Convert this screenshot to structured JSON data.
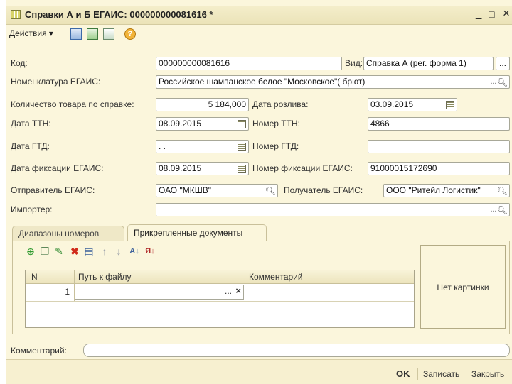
{
  "window": {
    "title": "Справки А и Б ЕГАИС: 000000000081616 *",
    "minimize": "_",
    "maximize": "□",
    "close": "×"
  },
  "toolbar": {
    "actions_label": "Действия ▾"
  },
  "form": {
    "code_label": "Код:",
    "code_value": "000000000081616",
    "kind_label": "Вид:",
    "kind_value": "Справка А (рег. форма 1)",
    "nomenclature_label": "Номенклатура ЕГАИС:",
    "nomenclature_value": "Российское шампанское белое \"Московское\"( брют)",
    "quantity_label": "Количество товара по справке:",
    "quantity_value": "5 184,000",
    "bottling_date_label": "Дата розлива:",
    "bottling_date_value": "03.09.2015",
    "ttn_date_label": "Дата ТТН:",
    "ttn_date_value": "08.09.2015",
    "ttn_number_label": "Номер ТТН:",
    "ttn_number_value": "4866",
    "gtd_date_label": "Дата ГТД:",
    "gtd_date_value": " .  .",
    "gtd_number_label": "Номер ГТД:",
    "gtd_number_value": "",
    "egais_fix_date_label": "Дата фиксации ЕГАИС:",
    "egais_fix_date_value": "08.09.2015",
    "egais_fix_number_label": "Номер фиксации ЕГАИС:",
    "egais_fix_number_value": "91000015172690",
    "sender_label": "Отправитель ЕГАИС:",
    "sender_value": "ОАО \"МКШВ\"",
    "receiver_label": "Получатель ЕГАИС:",
    "receiver_value": "ООО \"Ритейл Логистик\"",
    "importer_label": "Импортер:",
    "importer_value": "",
    "comment_label": "Комментарий:",
    "comment_value": ""
  },
  "tabs": [
    {
      "label": "Диапазоны номеров",
      "active": false
    },
    {
      "label": "Прикрепленные документы",
      "active": true
    }
  ],
  "grid": {
    "headers": [
      "N",
      "Путь к файлу",
      "Комментарий"
    ],
    "rows": [
      {
        "n": "1",
        "path": "",
        "comment": ""
      }
    ]
  },
  "picture": {
    "placeholder": "Нет картинки"
  },
  "bottom": {
    "ok": "OK",
    "save": "Записать",
    "close": "Закрыть"
  },
  "icons": {
    "add": "add-icon",
    "copy": "copy-icon",
    "edit": "edit-icon",
    "delete": "delete-icon",
    "save_row": "end-edit-icon",
    "up": "move-up-icon",
    "down": "move-down-icon",
    "sort_asc": "sort-ascending-icon",
    "sort_desc": "sort-descending-icon"
  }
}
